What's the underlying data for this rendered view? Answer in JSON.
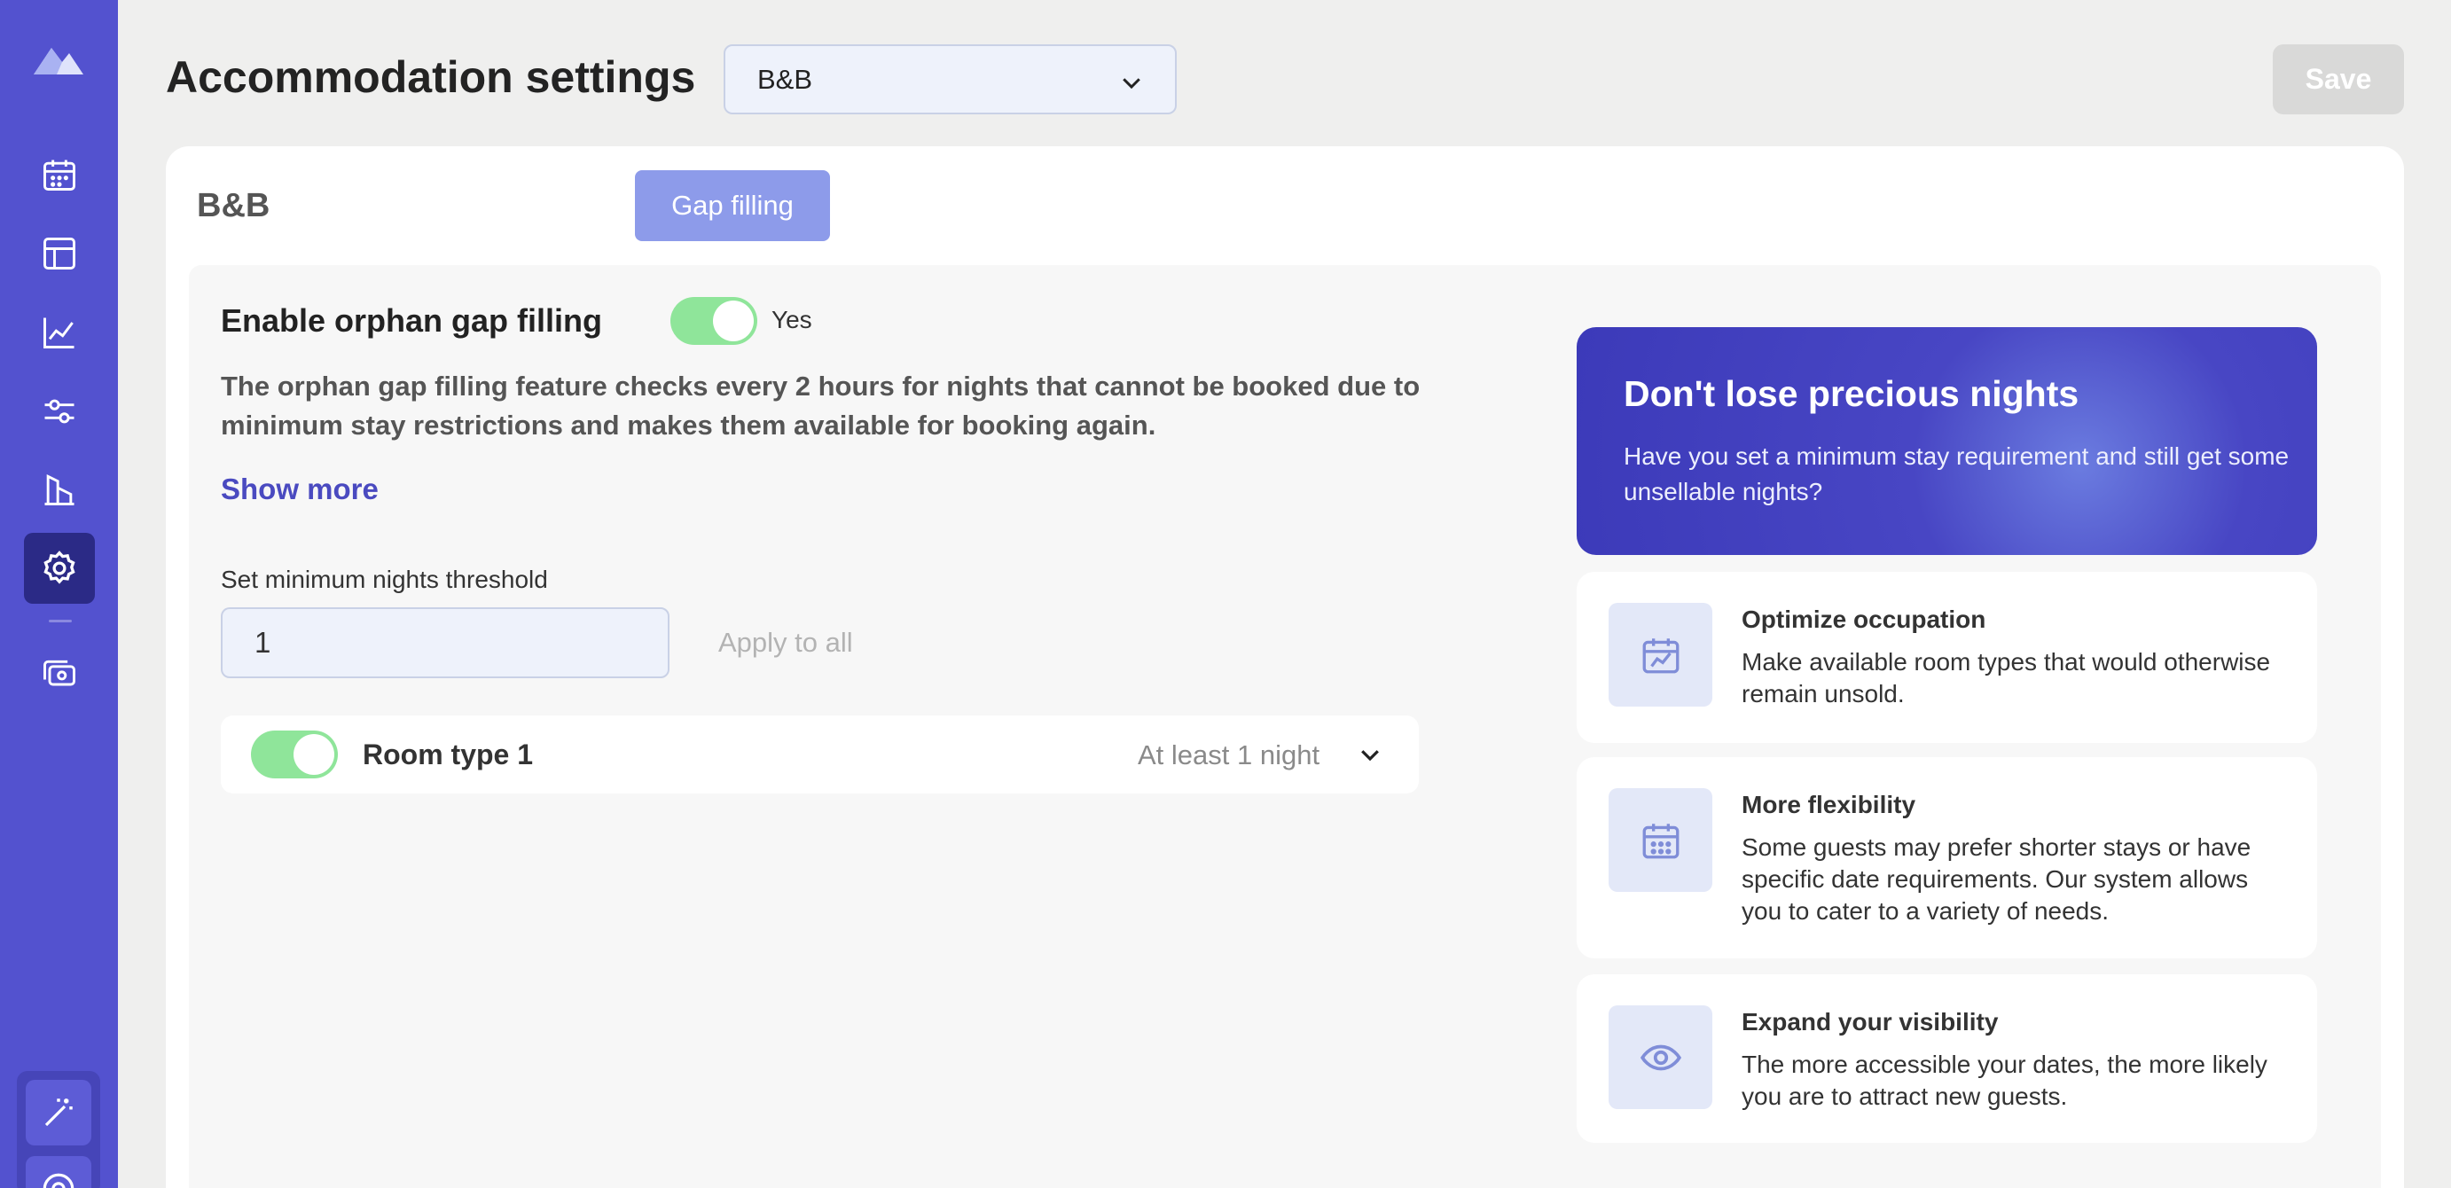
{
  "header": {
    "title": "Accommodation settings",
    "selected_accommodation": "B&B",
    "save_label": "Save"
  },
  "card": {
    "title": "B&B",
    "tabs": [
      {
        "label": "Gap filling",
        "active": true
      }
    ]
  },
  "gap_filling": {
    "enable_label": "Enable orphan gap filling",
    "enabled": true,
    "enabled_text": "Yes",
    "description": "The orphan gap filling feature checks every 2 hours for nights that cannot be booked due to minimum stay restrictions and makes them available for booking again.",
    "show_more": "Show more",
    "threshold_label": "Set minimum nights threshold",
    "threshold_value": "1",
    "apply_all": "Apply to all",
    "rooms": [
      {
        "name": "Room type 1",
        "enabled": true,
        "nights": "At least 1 night"
      }
    ]
  },
  "promo": {
    "title": "Don't lose precious nights",
    "text": "Have you set a minimum stay requirement and still get some unsellable nights?"
  },
  "features": [
    {
      "icon": "calendar-chart-icon",
      "title": "Optimize occupation",
      "text": "Make available room types that would otherwise remain unsold."
    },
    {
      "icon": "calendar-grid-icon",
      "title": "More flexibility",
      "text": "Some guests may prefer shorter stays or have specific date requirements. Our system allows you to cater to a variety of needs."
    },
    {
      "icon": "eye-icon",
      "title": "Expand your visibility",
      "text": "The more accessible your dates, the more likely you are to attract new guests."
    }
  ],
  "colors": {
    "sidebar": "#5352cf",
    "sidebar_active": "#2b2a86",
    "accent": "#4a4ac0",
    "toggle_on": "#8fe59a",
    "promo": "#3c3ab9"
  }
}
